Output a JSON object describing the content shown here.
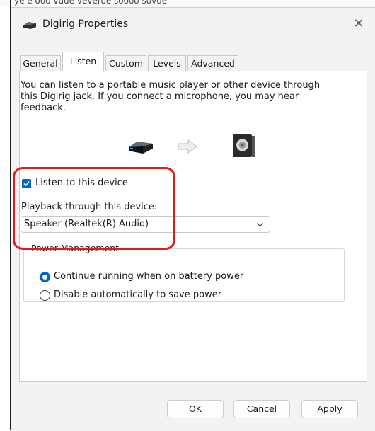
{
  "background_window_text": "ye e ooo vuue veveroe soooo sovue",
  "dialog": {
    "title": "Digirig Properties",
    "close_glyph": "✕"
  },
  "tabs": [
    {
      "label": "General",
      "active": false
    },
    {
      "label": "Listen",
      "active": true
    },
    {
      "label": "Custom",
      "active": false
    },
    {
      "label": "Levels",
      "active": false
    },
    {
      "label": "Advanced",
      "active": false
    }
  ],
  "listen": {
    "description": "You can listen to a portable music player or other device through\nthis Digirig jack.  If you connect a microphone, you may hear\nfeedback.",
    "listen_checkbox_label": "Listen to this device",
    "listen_checked": true,
    "playback_label": "Playback through this device:",
    "playback_device": "Speaker (Realtek(R) Audio)"
  },
  "power_management": {
    "title": "Power Management",
    "options": [
      {
        "label": "Continue running when on battery power",
        "selected": true
      },
      {
        "label": "Disable automatically to save power",
        "selected": false
      }
    ]
  },
  "buttons": {
    "ok": "OK",
    "cancel": "Cancel",
    "apply": "Apply"
  },
  "icons": {
    "title": "audio-device-icon",
    "source": "digirig-device-icon",
    "flow": "right-arrow-icon",
    "target": "speaker-icon"
  },
  "colors": {
    "accent": "#0066cc",
    "highlight": "#e01c1c"
  }
}
